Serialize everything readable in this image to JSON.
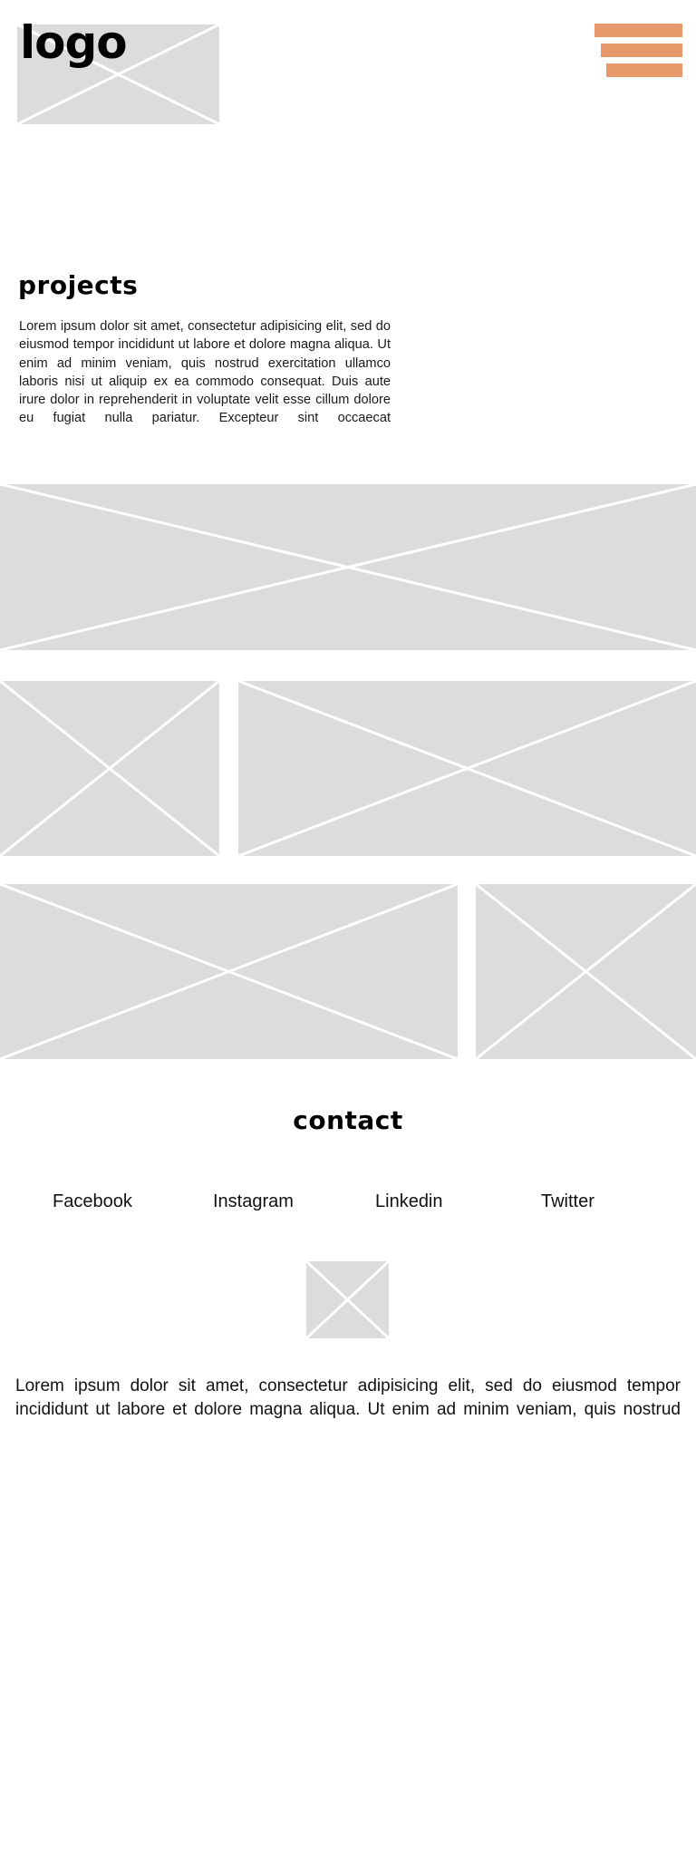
{
  "header": {
    "logo_text": "logo",
    "menu_color": "#e8996b",
    "menu_icon": "hamburger-menu-icon"
  },
  "projects": {
    "title": "projects",
    "body": "Lorem ipsum dolor sit amet, consectetur adipisicing elit, sed do eiusmod tempor incididunt ut labore et dolore magna aliqua. Ut enim ad minim veniam, quis nostrud exercitation ullamco laboris nisi ut aliquip ex ea commodo consequat. Duis aute irure dolor in reprehenderit in voluptate velit esse cillum dolore eu fugiat nulla pariatur. Excepteur sint occaecat"
  },
  "contact": {
    "title": "contact",
    "links": [
      "Facebook",
      "Instagram",
      "Linkedin",
      "Twitter"
    ]
  },
  "footer": {
    "text": "Lorem ipsum dolor sit amet, consectetur adipisicing elit, sed do eiusmod tempor incididunt ut labore et dolore magna aliqua. Ut enim ad minim veniam, quis nostrud"
  },
  "colors": {
    "placeholder": "#dcdcdc",
    "placeholder_lines": "#ffffff"
  }
}
